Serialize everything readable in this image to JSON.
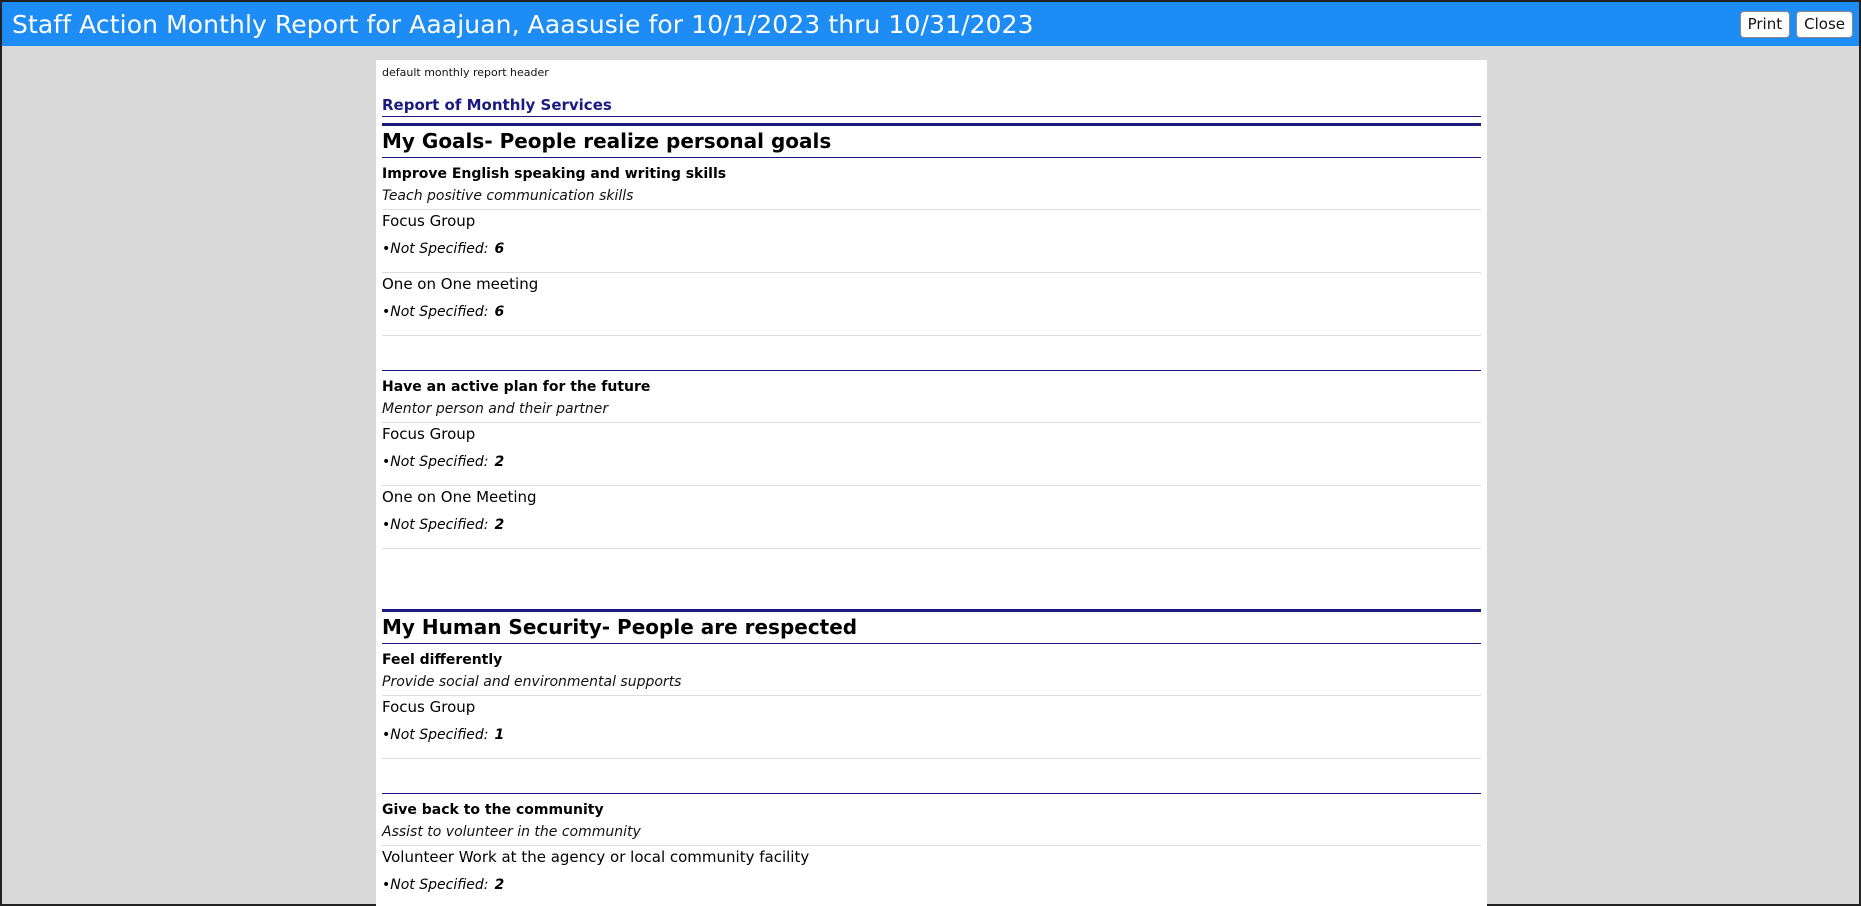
{
  "window": {
    "title": "Staff Action Monthly Report for Aaajuan, Aaasusie for 10/1/2023 thru 10/31/2023",
    "print_label": "Print",
    "close_label": "Close"
  },
  "report": {
    "header_text": "default monthly report header",
    "title": "Report of Monthly Services",
    "sections": [
      {
        "heading": "My Goals- People realize personal goals",
        "goals": [
          {
            "title": "Improve English speaking and writing skills",
            "subtitle": "Teach positive communication skills",
            "services": [
              {
                "name": "Focus Group",
                "label": "•Not Specified:",
                "count": "6"
              },
              {
                "name": "One on One meeting",
                "label": "•Not Specified:",
                "count": "6"
              }
            ]
          },
          {
            "title": "Have an active plan for the future",
            "subtitle": "Mentor person and their partner",
            "services": [
              {
                "name": "Focus Group",
                "label": "•Not Specified:",
                "count": "2"
              },
              {
                "name": "One on One Meeting",
                "label": "•Not Specified:",
                "count": "2"
              }
            ]
          }
        ]
      },
      {
        "heading": "My Human Security- People are respected",
        "goals": [
          {
            "title": "Feel differently",
            "subtitle": "Provide social and environmental supports",
            "services": [
              {
                "name": "Focus Group",
                "label": "•Not Specified:",
                "count": "1"
              }
            ]
          },
          {
            "title": "Give back to the community",
            "subtitle": "Assist to volunteer in the community",
            "services": [
              {
                "name": "Volunteer Work at the agency or local community facility",
                "label": "•Not Specified:",
                "count": "2"
              }
            ]
          }
        ]
      }
    ]
  }
}
